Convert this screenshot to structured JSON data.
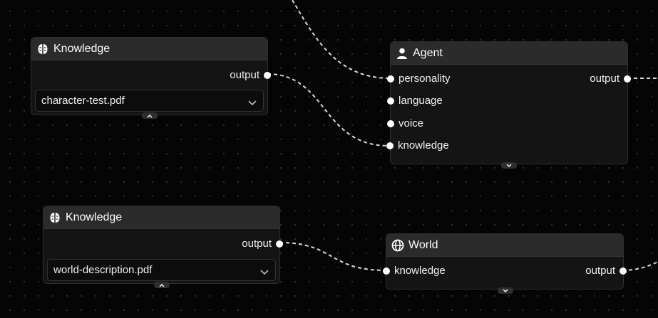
{
  "nodes": {
    "knowledge_1": {
      "title": "Knowledge",
      "output_label": "output",
      "file_select": "character-test.pdf",
      "icon": "brain-icon"
    },
    "knowledge_2": {
      "title": "Knowledge",
      "output_label": "output",
      "file_select": "world-description.pdf",
      "icon": "brain-icon"
    },
    "agent": {
      "title": "Agent",
      "icon": "user-icon",
      "inputs": [
        "personality",
        "language",
        "voice",
        "knowledge"
      ],
      "output_label": "output"
    },
    "world": {
      "title": "World",
      "icon": "globe-icon",
      "inputs": [
        "knowledge"
      ],
      "output_label": "output"
    }
  },
  "colors": {
    "canvas_bg": "#050505",
    "node_bg": "#141414",
    "header_bg": "#2b2b2b",
    "edge": "#d9d9d9",
    "port": "#ffffff"
  }
}
